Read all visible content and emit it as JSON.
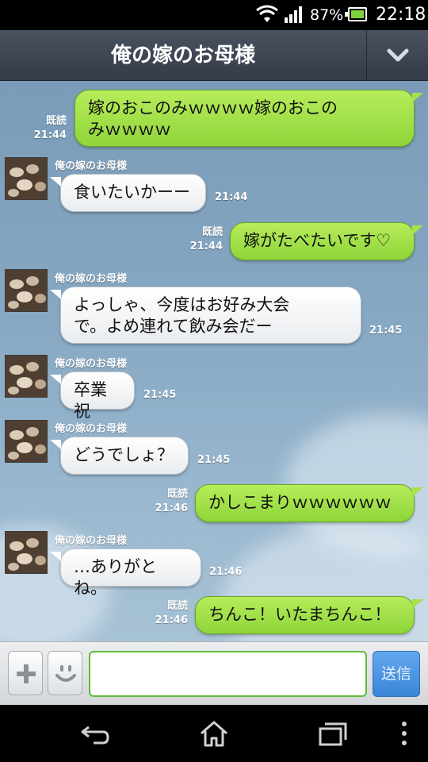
{
  "status_bar": {
    "battery_percent": "87%",
    "time": "22:18"
  },
  "header": {
    "title": "俺の嫁のお母様",
    "menu_icon": "chevron-down-icon"
  },
  "chat": {
    "messages": [
      {
        "side": "right",
        "read": "既読",
        "time": "21:44",
        "text_line1": "嫁のおこのみｗｗｗｗ嫁のおこの",
        "text_line2": "みｗｗｗｗ"
      },
      {
        "side": "left",
        "sender": "俺の嫁のお母様",
        "time": "21:44",
        "text": "食いたいかーー"
      },
      {
        "side": "right",
        "read": "既読",
        "time": "21:44",
        "text": "嫁がたべたいです♡"
      },
      {
        "side": "left",
        "sender": "俺の嫁のお母様",
        "time": "21:45",
        "text_line1": "よっしゃ、今度はお好み大会",
        "text_line2": "で。よめ連れて飲み会だー"
      },
      {
        "side": "left",
        "sender": "俺の嫁のお母様",
        "time": "21:45",
        "text": "卒業祝"
      },
      {
        "side": "left",
        "sender": "俺の嫁のお母様",
        "time": "21:45",
        "text": "どうでしょ？"
      },
      {
        "side": "right",
        "read": "既読",
        "time": "21:46",
        "text": "かしこまりｗｗｗｗｗｗ"
      },
      {
        "side": "left",
        "sender": "俺の嫁のお母様",
        "time": "21:46",
        "text": "…ありがとね。"
      },
      {
        "side": "right",
        "read": "既読",
        "time": "21:46",
        "text": "ちんこ！いたまちんこ！"
      }
    ]
  },
  "input_bar": {
    "message_value": "",
    "send_label": "送信"
  },
  "colors": {
    "outgoing_bubble": "#a5e24b",
    "incoming_bubble": "#ffffff",
    "send_button": "#4a95e2"
  }
}
